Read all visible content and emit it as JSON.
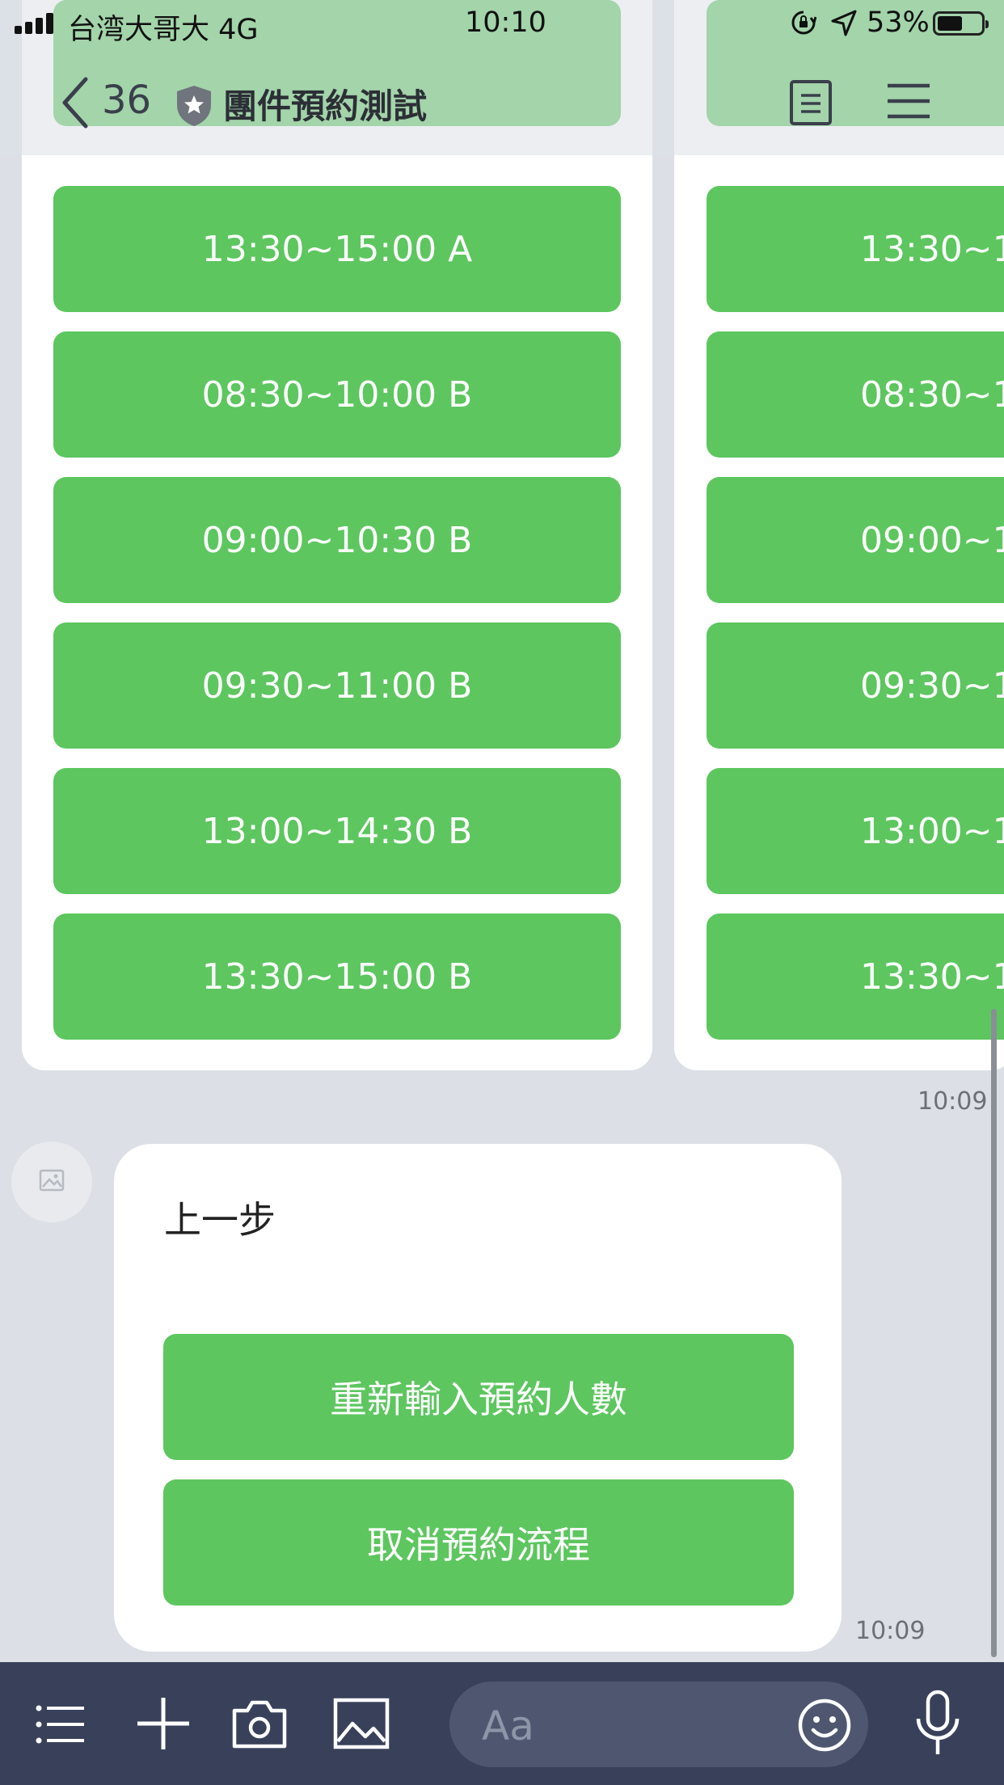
{
  "status_bar": {
    "carrier": "台湾大哥大 4G",
    "time": "10:10",
    "battery_percent": "53%",
    "icons": [
      "signal-icon",
      "rotation-lock-icon",
      "location-icon",
      "battery-icon"
    ]
  },
  "header": {
    "back_count": "36",
    "title": "團件預約測試",
    "icons": [
      "back-chevron-icon",
      "shield-icon",
      "note-icon",
      "menu-icon"
    ]
  },
  "carousel": {
    "card1_slots": [
      "13:30~15:00 A",
      "08:30~10:00 B",
      "09:00~10:30 B",
      "09:30~11:00 B",
      "13:00~14:30 B",
      "13:30~15:00 B"
    ],
    "card2_slots": [
      "13:30~1",
      "08:30~1",
      "09:00~1",
      "09:30~1",
      "13:00~1",
      "13:30~1"
    ],
    "timestamp": "10:09"
  },
  "quick_reply": {
    "title": "上一步",
    "buttons": [
      "重新輸入預約人數",
      "取消預約流程"
    ],
    "timestamp": "10:09"
  },
  "input_bar": {
    "placeholder": "Aa",
    "icons": [
      "list-icon",
      "plus-icon",
      "camera-icon",
      "image-icon",
      "emoji-icon",
      "microphone-icon"
    ]
  },
  "colors": {
    "accent_green": "#5dc65f",
    "chat_background": "#dcdfe6",
    "input_bar": "#39415a"
  }
}
